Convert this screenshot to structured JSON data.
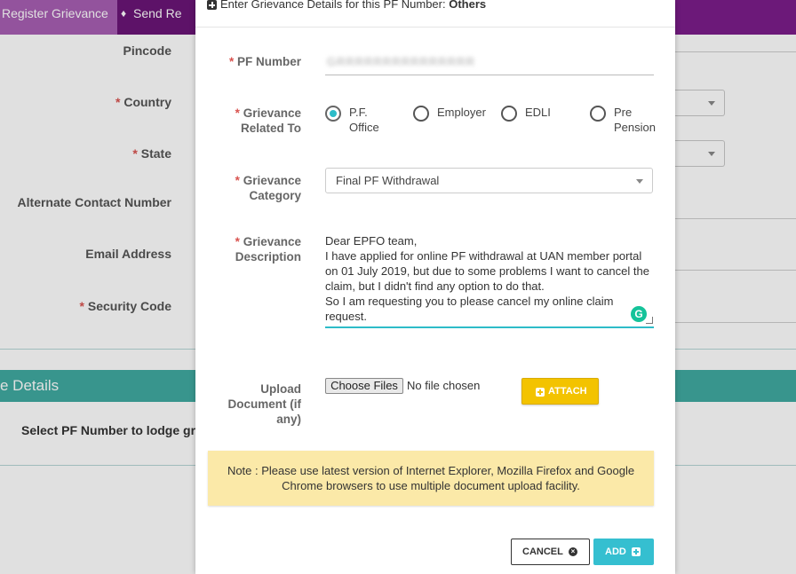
{
  "background": {
    "nav": {
      "register_tab": "Register Grievance",
      "send_tab": "Send Re"
    },
    "form_labels": {
      "pincode": "Pincode",
      "country": "Country",
      "state": "State",
      "alternate_contact": "Alternate Contact Number",
      "email": "Email Address",
      "security_code": "Security Code"
    },
    "required_mark": "*",
    "section_title": "e Details",
    "select_pf_text": "Select PF Number to lodge grieva"
  },
  "modal": {
    "header_prefix": "Enter Grievance Details for this PF Number:",
    "header_value": "Others",
    "labels": {
      "pf_number": "PF Number",
      "grievance_related_to": "Grievance Related To",
      "grievance_category": "Grievance Category",
      "grievance_description": "Grievance Description",
      "upload_document": "Upload Document (if any)"
    },
    "required_mark": "*",
    "pf_number_value": "GRRRRRRRRRRRRRRR",
    "radio_options": [
      {
        "label": "P.F. Office",
        "checked": true
      },
      {
        "label": "Employer",
        "checked": false
      },
      {
        "label": "EDLI",
        "checked": false
      },
      {
        "label": "Pre Pension",
        "checked": false
      }
    ],
    "category_selected": "Final PF Withdrawal",
    "description": "Dear EPFO team,\nI have applied for online PF withdrawal at UAN member portal on 01 July 2019, but due to some problems I want to cancel the claim, but I didn't find any option to do that.\nSo I am requesting you to please cancel my online claim request.",
    "grammarly_glyph": "G",
    "choose_files_label": "Choose Files",
    "file_status": "No file chosen",
    "attach_label": "ATTACH",
    "note": "Note : Please use latest version of Internet Explorer, Mozilla Firefox and Google Chrome browsers to use multiple document upload facility.",
    "cancel_label": "CANCEL",
    "cancel_glyph": "×",
    "add_label": "ADD"
  },
  "colors": {
    "nav_bg": "#7c1d8a",
    "nav_active": "#a85fb3",
    "teal_section": "#40aaa1",
    "radio_accent": "#2dbcc8",
    "attach_yellow": "#f3c300",
    "add_blue": "#35bfd0",
    "note_bg": "#fbe9a8",
    "required_red": "#d9534f"
  },
  "icons": {
    "nav_send": "bell-icon",
    "header_plus": "plus-square-icon",
    "attach": "plus-square-icon",
    "cancel": "times-circle-icon",
    "add": "plus-square-icon",
    "grammarly": "grammarly-icon"
  }
}
